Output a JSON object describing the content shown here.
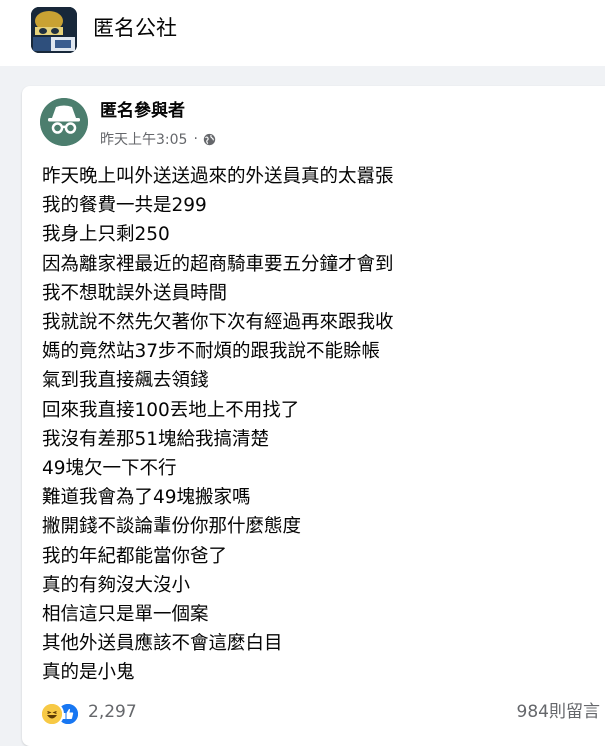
{
  "group": {
    "name": "匿名公社"
  },
  "post": {
    "author": "匿名參與者",
    "timestamp": "昨天上午3:05",
    "dot": "·",
    "privacy_icon": "globe-icon",
    "lines": [
      "昨天晚上叫外送送過來的外送員真的太囂張",
      "我的餐費一共是299",
      "我身上只剩250",
      "因為離家裡最近的超商騎車要五分鐘才會到",
      "我不想耽誤外送員時間",
      "我就說不然先欠著你下次有經過再來跟我收",
      "媽的竟然站37步不耐煩的跟我說不能賒帳",
      "氣到我直接飆去領錢",
      "回來我直接100丟地上不用找了",
      "我沒有差那51塊給我搞清楚",
      "49塊欠一下不行",
      "難道我會為了49塊搬家嗎",
      "撇開錢不談論輩份你那什麼態度",
      "我的年紀都能當你爸了",
      "真的有夠沒大沒小",
      "相信這只是單一個案",
      "其他外送員應該不會這麼白目",
      "真的是小鬼"
    ],
    "reaction_icons": [
      "haha-icon",
      "like-icon"
    ],
    "reaction_count": "2,297",
    "comment_count": "984則留言"
  },
  "colors": {
    "background": "#f0f2f5",
    "card": "#ffffff",
    "meta_text": "#65676b",
    "like_blue": "#1877f2",
    "haha_yellow": "#f7c945",
    "avatar_green": "#4c7e6e"
  }
}
